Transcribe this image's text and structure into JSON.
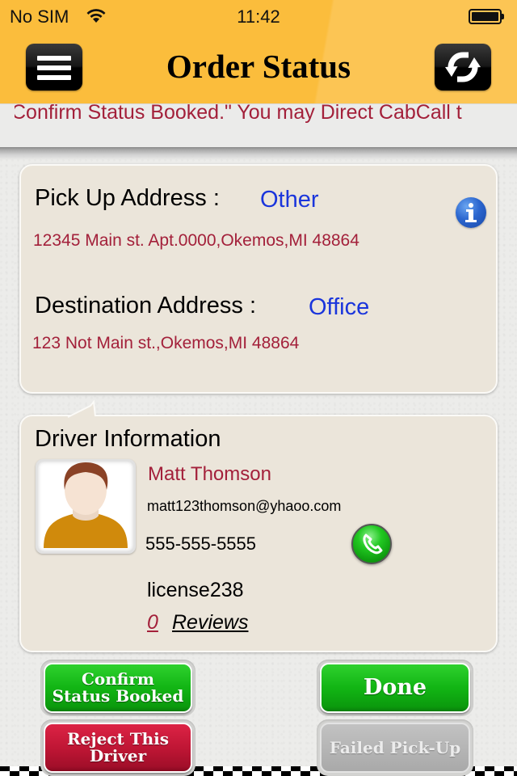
{
  "status_bar": {
    "carrier": "No SIM",
    "time": "11:42",
    "wifi_icon": "wifi-icon",
    "battery_icon": "battery-icon",
    "battery_level": 1.0
  },
  "header": {
    "title": "Order Status",
    "menu_icon": "hamburger-menu-icon",
    "refresh_icon": "refresh-icon",
    "background_color": "#fbbd3c"
  },
  "ticker": {
    "text": "Confirm Status Booked.\" You may Direct CabCall t",
    "color": "#a3203a"
  },
  "pickup": {
    "label": "Pick Up Address :",
    "type": "Other",
    "address": "12345 Main st. Apt.0000,Okemos,MI 48864",
    "info_icon": "info-icon"
  },
  "destination": {
    "label": "Destination Address :",
    "type": "Office",
    "address": "123 Not Main st.,Okemos,MI 48864"
  },
  "driver": {
    "section_title": "Driver Information",
    "avatar_icon": "person-avatar-icon",
    "name": "Matt Thomson",
    "email": "matt123thomson@yhaoo.com",
    "phone": "555-555-5555",
    "call_icon": "phone-call-icon",
    "license": "license238",
    "review_count": "0",
    "reviews_label": "Reviews"
  },
  "actions": {
    "confirm_label_line1": "Confirm",
    "confirm_label_line2": "Status Booked",
    "done_label": "Done",
    "reject_label_line1": "Reject This",
    "reject_label_line2": "Driver",
    "failed_label": "Failed Pick-Up",
    "failed_enabled": false
  },
  "colors": {
    "accent_red": "#a3203a",
    "link_blue": "#1a35dc",
    "button_green": "#12b514",
    "button_red": "#c01635",
    "button_disabled": "#b3b3b3",
    "card_bg": "#ebe5da"
  }
}
